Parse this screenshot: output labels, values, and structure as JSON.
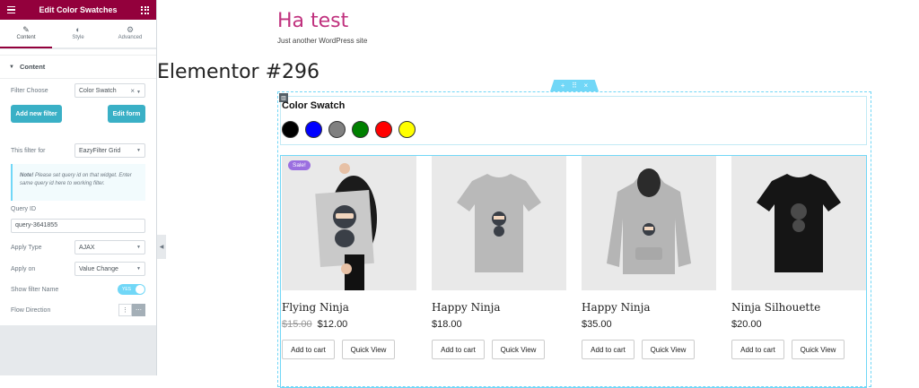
{
  "panel": {
    "title": "Edit Color Swatches",
    "tabs": [
      {
        "label": "Content",
        "icon": "pencil-icon"
      },
      {
        "label": "Style",
        "icon": "half-circle-icon"
      },
      {
        "label": "Advanced",
        "icon": "gear-icon"
      }
    ],
    "section_title": "Content",
    "filter_choose_label": "Filter Choose",
    "filter_choose_value": "Color Swatch",
    "add_filter_label": "Add new filter",
    "edit_form_label": "Edit form",
    "filter_for_label": "This filter for",
    "filter_for_value": "EazyFilter Grid",
    "note_bold": "Note!",
    "note_text": " Please set query id on that widget. Enter same query id here to working filter.",
    "query_id_label": "Query ID",
    "query_id_value": "query-3641855",
    "apply_type_label": "Apply Type",
    "apply_type_value": "AJAX",
    "apply_on_label": "Apply on",
    "apply_on_value": "Value Change",
    "show_name_label": "Show filter Name",
    "show_name_toggle": "YES",
    "flow_label": "Flow Direction",
    "colors": {
      "brand": "#93003c",
      "accent": "#3ab0c6",
      "toggle": "#71d7f7"
    }
  },
  "site": {
    "title": "Ha test",
    "tagline": "Just another WordPress site",
    "page_title": "Elementor #296"
  },
  "swatch": {
    "title": "Color Swatch",
    "colors": [
      "#000000",
      "#0000ff",
      "#808080",
      "#008000",
      "#ff0000",
      "#ffff00"
    ]
  },
  "products": [
    {
      "name": "Flying Ninja",
      "old_price": "$15.00",
      "price": "$12.00",
      "badge": "Sale!",
      "cart": "Add to cart",
      "quick": "Quick View"
    },
    {
      "name": "Happy Ninja",
      "old_price": "",
      "price": "$18.00",
      "badge": "",
      "cart": "Add to cart",
      "quick": "Quick View"
    },
    {
      "name": "Happy Ninja",
      "old_price": "",
      "price": "$35.00",
      "badge": "",
      "cart": "Add to cart",
      "quick": "Quick View"
    },
    {
      "name": "Ninja Silhouette",
      "old_price": "",
      "price": "$20.00",
      "badge": "",
      "cart": "Add to cart",
      "quick": "Quick View"
    }
  ]
}
